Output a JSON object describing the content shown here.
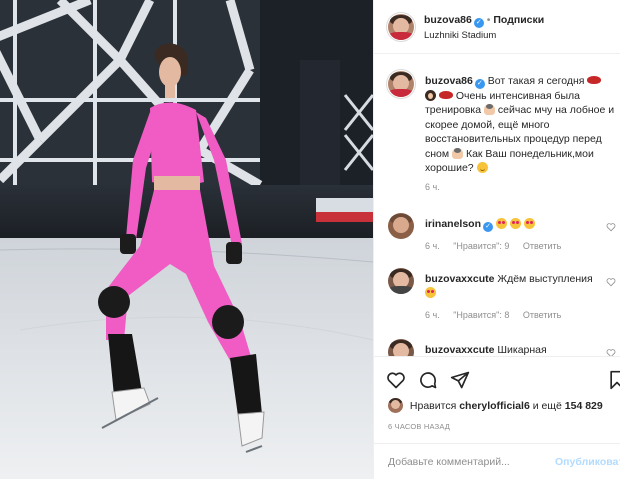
{
  "post": {
    "author": "buzova86",
    "follow_label": "Подписки",
    "location": "Luzhniki Stadium",
    "caption_author": "buzova86",
    "caption_part1": "Вот такая я сегодня",
    "caption_part2": "Очень интенсивная была тренировка",
    "caption_part3": "сейчас мчу на лобное и скорее домой, ещё много восстановительных процедур перед сном",
    "caption_part4": "Как Ваш понедельник,мои хорошие?",
    "caption_time": "6 ч."
  },
  "comments": [
    {
      "user": "irinanelson",
      "text": "",
      "time": "6 ч.",
      "likes": "\"Нравится\": 9",
      "reply": "Ответить"
    },
    {
      "user": "buzovaxxcute",
      "text": "Ждём выступления",
      "time": "6 ч.",
      "likes": "\"Нравится\": 8",
      "reply": "Ответить"
    },
    {
      "user": "buzovaxxcute",
      "text": "Шикарная"
    }
  ],
  "likes": {
    "prefix": "Нравится",
    "user": "cherylofficial6",
    "middle": "и ещё",
    "count": "154 829"
  },
  "timestamp": "6 часов назад",
  "add_comment": {
    "placeholder": "Добавьте комментарий...",
    "publish": "Опубликовать"
  },
  "icons": [
    "verified-icon",
    "heart-icon",
    "comment-icon",
    "share-icon",
    "bookmark-icon"
  ],
  "colors": {
    "verified": "#3897f0",
    "outfit_pink": "#f05cc4",
    "publish_disabled": "#b3dbff",
    "muted": "#8e8e8e"
  }
}
